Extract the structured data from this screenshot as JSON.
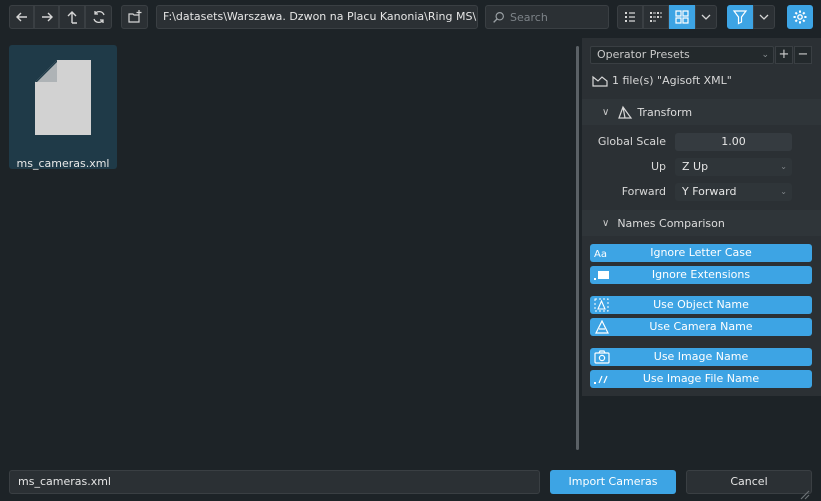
{
  "toolbar": {
    "path": "F:\\datasets\\Warszawa. Dzwon na Placu Kanonia\\Ring MS\\...",
    "search_placeholder": "Search"
  },
  "files": [
    {
      "name": "ms_cameras.xml"
    }
  ],
  "side_panel": {
    "presets_label": "Operator Presets",
    "add_symbol": "+",
    "remove_symbol": "−",
    "file_count": "1 file(s) \"Agisoft XML\"",
    "transform": {
      "title": "Transform",
      "global_scale_label": "Global Scale",
      "global_scale_value": "1.00",
      "up_label": "Up",
      "up_value": "Z Up",
      "forward_label": "Forward",
      "forward_value": "Y Forward"
    },
    "names_comparison": {
      "title": "Names Comparison",
      "buttons": [
        "Ignore Letter Case",
        "Ignore Extensions",
        "Use Object Name",
        "Use Camera Name",
        "Use Image Name",
        "Use Image File Name"
      ]
    }
  },
  "bottom": {
    "filename": "ms_cameras.xml",
    "import_label": "Import Cameras",
    "cancel_label": "Cancel"
  },
  "colors": {
    "accent": "#3da4e4",
    "background": "#1d2327",
    "panel": "#2b3034",
    "selected_file": "#1f3a48"
  }
}
